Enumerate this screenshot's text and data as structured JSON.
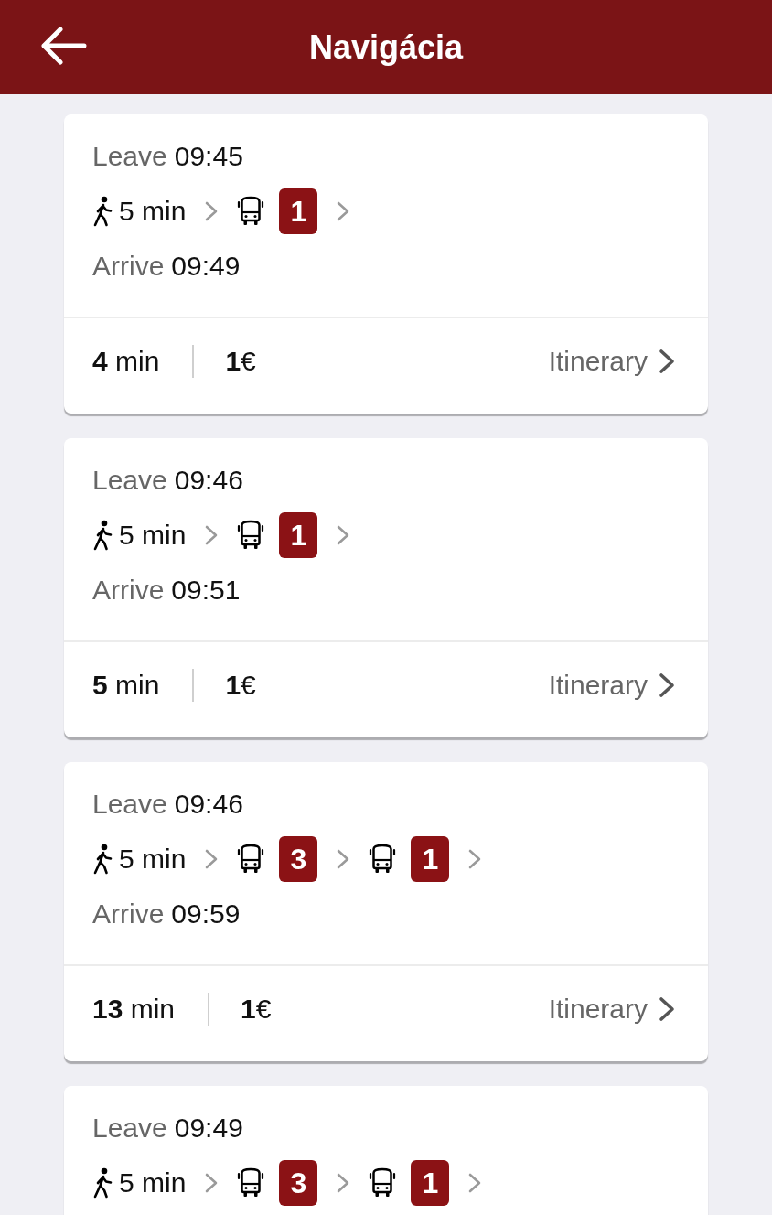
{
  "header": {
    "title": "Navigácia"
  },
  "routes": [
    {
      "leave_label": "Leave",
      "leave_time": "09:45",
      "legs": [
        {
          "kind": "walk",
          "duration": "5 min"
        },
        {
          "kind": "bus",
          "line": "1"
        }
      ],
      "arrive_label": "Arrive",
      "arrive_time": "09:49",
      "duration": "**4** min",
      "price": "**1**€",
      "itinerary": "Itinerary"
    },
    {
      "leave_label": "Leave",
      "leave_time": "09:46",
      "legs": [
        {
          "kind": "walk",
          "duration": "5 min"
        },
        {
          "kind": "bus",
          "line": "1"
        }
      ],
      "arrive_label": "Arrive",
      "arrive_time": "09:51",
      "duration": "**5** min",
      "price": "**1**€",
      "itinerary": "Itinerary"
    },
    {
      "leave_label": "Leave",
      "leave_time": "09:46",
      "legs": [
        {
          "kind": "walk",
          "duration": "5 min"
        },
        {
          "kind": "bus",
          "line": "3"
        },
        {
          "kind": "bus",
          "line": "1"
        }
      ],
      "arrive_label": "Arrive",
      "arrive_time": "09:59",
      "duration": "**13** min",
      "price": "**1**€",
      "itinerary": "Itinerary"
    },
    {
      "leave_label": "Leave",
      "leave_time": "09:49",
      "legs": [
        {
          "kind": "walk",
          "duration": "5 min"
        },
        {
          "kind": "bus",
          "line": "3"
        },
        {
          "kind": "bus",
          "line": "1"
        }
      ]
    }
  ]
}
